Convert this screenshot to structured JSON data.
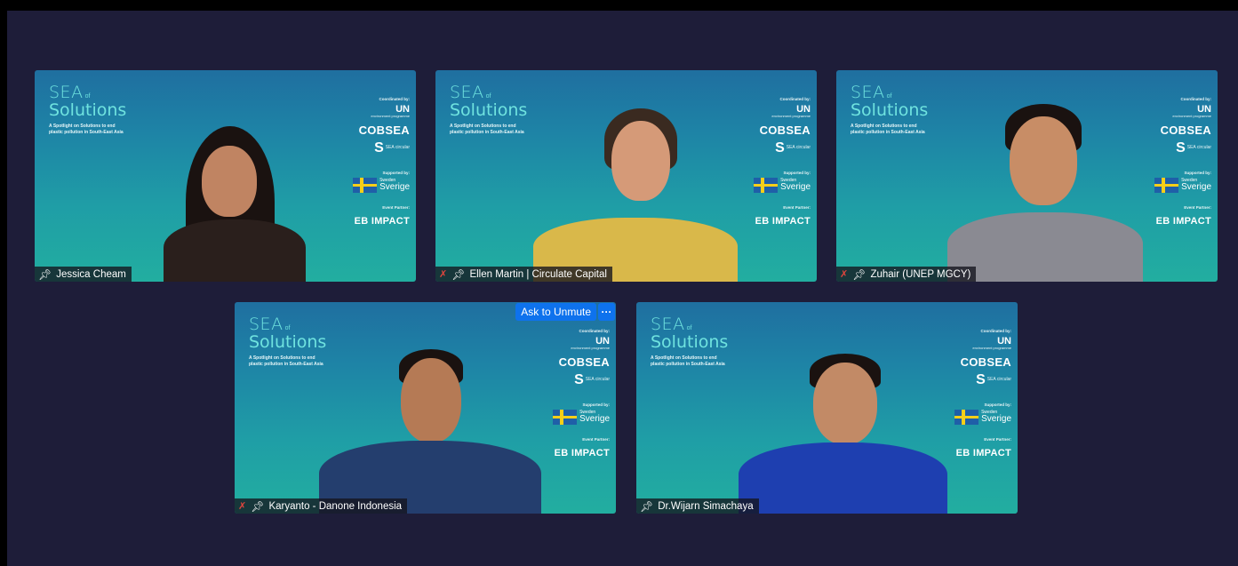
{
  "participants": [
    {
      "name": "Jessica Cheam",
      "muted": false
    },
    {
      "name": "Ellen Martin | Circulate Capital",
      "muted": true
    },
    {
      "name": "Zuhair (UNEP MGCY)",
      "muted": true
    },
    {
      "name": "Karyanto - Danone Indonesia",
      "muted": true
    },
    {
      "name": "Dr.Wijarn Simachaya",
      "muted": false
    }
  ],
  "background": {
    "sea": "SEA",
    "of": "of",
    "solutions": "Solutions",
    "tagline": "A Spotlight on Solutions to end plastic pollution in South-East Asia",
    "coordinated_by": "Coordinated by:",
    "un": "UN",
    "un_sub": "environment programme",
    "cobsea": "COBSEA",
    "sea_circular": "SEA circular",
    "supported_by": "Supported by:",
    "sweden_small": "Sweden",
    "sweden_big": "Sverige",
    "event_partner": "Event Partner:",
    "eb_impact": "EB IMPACT"
  },
  "controls": {
    "ask_to_unmute": "Ask to Unmute",
    "more": "···"
  },
  "icons": {
    "pin": "pin-icon",
    "mic_off": "microphone-muted-icon"
  },
  "colors": {
    "window_bg": "#1e1d39",
    "tile_top": "#1f6fa0",
    "tile_bottom": "#22aea0",
    "accent_blue": "#0e72ed",
    "muted_red": "#e0453d",
    "brand_teal": "#6fe3df"
  }
}
